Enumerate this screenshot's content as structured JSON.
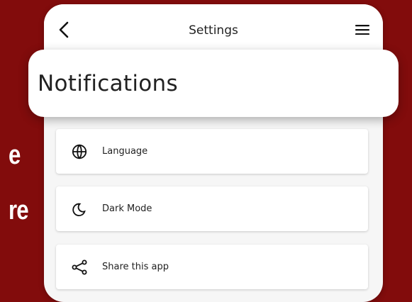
{
  "background": {
    "color": "#820c0c",
    "partial_text": [
      "e",
      "re"
    ]
  },
  "app_bar": {
    "title": "Settings",
    "back_icon": "chevron-left-icon",
    "menu_icon": "hamburger-menu-icon"
  },
  "highlighted_item": {
    "label": "Notifications"
  },
  "settings": {
    "items": [
      {
        "label": "Language",
        "icon": "globe-icon"
      },
      {
        "label": "Dark Mode",
        "icon": "moon-icon"
      },
      {
        "label": "Share this app",
        "icon": "share-icon"
      }
    ]
  },
  "colors": {
    "brand_background": "#820c0c",
    "card": "#ffffff",
    "text": "#222222"
  }
}
